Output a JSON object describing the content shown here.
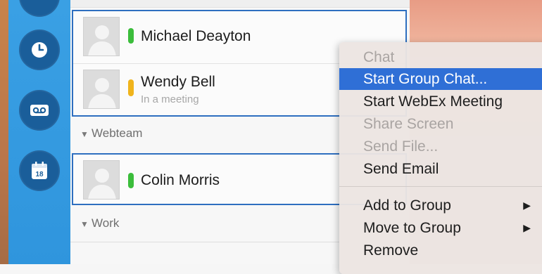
{
  "contacts_top": [
    {
      "name": "Michael Deayton",
      "status": "",
      "presence_color": "#3bbd3b"
    },
    {
      "name": "Wendy Bell",
      "status": "In a meeting",
      "presence_color": "#f0b41c"
    }
  ],
  "groups": [
    {
      "label": "Webteam",
      "contacts": [
        {
          "name": "Colin Morris",
          "presence_color": "#3bbd3b"
        }
      ]
    },
    {
      "label": "Work",
      "contacts": []
    }
  ],
  "sidebar": {
    "icons": [
      "recent-clock-icon",
      "voicemail-icon",
      "calendar-icon"
    ],
    "calendar_day": "18"
  },
  "context_menu": {
    "items": [
      {
        "label": "Chat",
        "state": "disabled"
      },
      {
        "label": "Start Group Chat...",
        "state": "highlighted"
      },
      {
        "label": "Start WebEx Meeting",
        "state": "enabled"
      },
      {
        "label": "Share Screen",
        "state": "disabled"
      },
      {
        "label": "Send File...",
        "state": "disabled"
      },
      {
        "label": "Send Email",
        "state": "enabled"
      },
      {
        "label": "Add to Group",
        "state": "enabled",
        "submenu": true
      },
      {
        "label": "Move to Group",
        "state": "enabled",
        "submenu": true
      },
      {
        "label": "Remove",
        "state": "enabled"
      }
    ],
    "submenu_glyph": "▶"
  },
  "colors": {
    "selection_border": "#2e6fc0",
    "menu_highlight": "#2f6fd6",
    "sidebar_blue": "#3aa0e4"
  }
}
